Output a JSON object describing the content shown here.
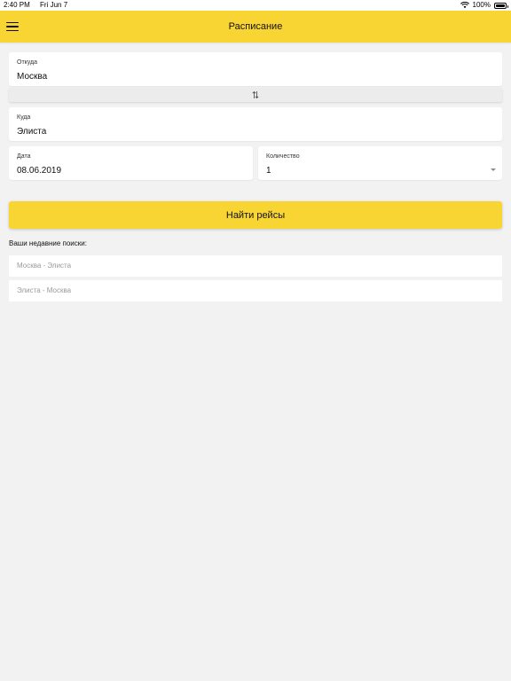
{
  "status_bar": {
    "time": "2:40 PM",
    "date": "Fri Jun 7",
    "battery": "100%",
    "icons": [
      "wifi-icon",
      "battery-icon"
    ]
  },
  "header": {
    "title": "Расписание",
    "menu_icon": "hamburger-menu-icon"
  },
  "form": {
    "from": {
      "label": "Откуда",
      "value": "Москва"
    },
    "swap_icon": "swap-arrows-icon",
    "to": {
      "label": "Куда",
      "value": "Элиста"
    },
    "date": {
      "label": "Дата",
      "value": "08.06.2019"
    },
    "count": {
      "label": "Количество",
      "value": "1"
    },
    "search_button": "Найти рейсы"
  },
  "recent": {
    "title": "Ваши недавние поиски:",
    "items": [
      "Москва - Элиста",
      "Элиста - Москва"
    ]
  },
  "colors": {
    "accent": "#f9d533",
    "background": "#f2f2f2",
    "card": "#ffffff",
    "muted_text": "#9a9a9a"
  }
}
